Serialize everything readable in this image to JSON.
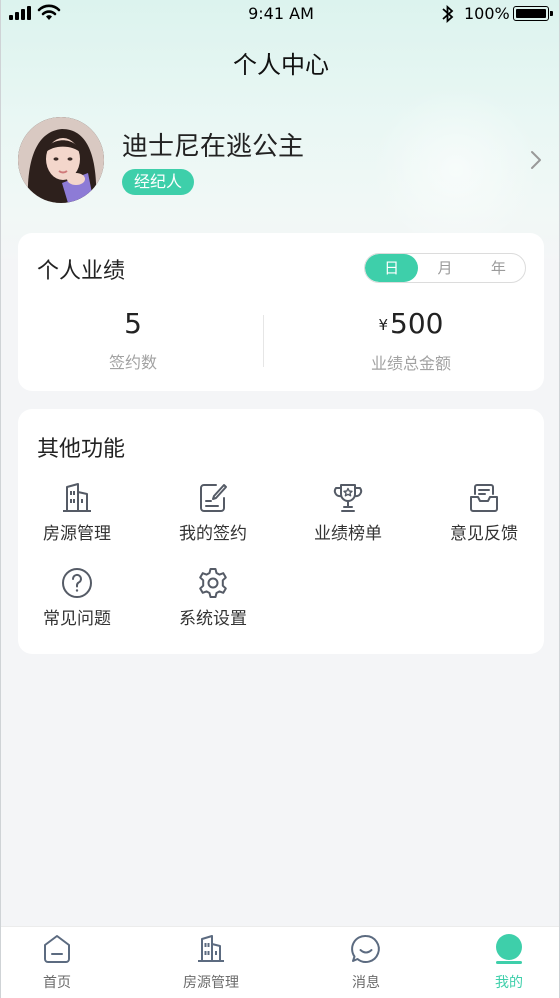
{
  "status_bar": {
    "time": "9:41 AM",
    "battery": "100%"
  },
  "header": {
    "title": "个人中心"
  },
  "profile": {
    "name": "迪士尼在逃公主",
    "role": "经纪人"
  },
  "performance": {
    "title": "个人业绩",
    "periods": [
      "日",
      "月",
      "年"
    ],
    "active_period": "日",
    "contracts": {
      "value": "5",
      "label": "签约数"
    },
    "total": {
      "currency": "¥",
      "value": "500",
      "label": "业绩总金额"
    }
  },
  "functions": {
    "title": "其他功能",
    "items": [
      {
        "label": "房源管理",
        "icon": "building-icon"
      },
      {
        "label": "我的签约",
        "icon": "edit-document-icon"
      },
      {
        "label": "业绩榜单",
        "icon": "trophy-icon"
      },
      {
        "label": "意见反馈",
        "icon": "inbox-icon"
      },
      {
        "label": "常见问题",
        "icon": "question-icon"
      },
      {
        "label": "系统设置",
        "icon": "gear-icon"
      }
    ]
  },
  "tabs": [
    {
      "label": "首页",
      "icon": "home-icon"
    },
    {
      "label": "房源管理",
      "icon": "building-icon"
    },
    {
      "label": "消息",
      "icon": "chat-icon"
    },
    {
      "label": "我的",
      "icon": "user-icon",
      "active": true
    }
  ],
  "colors": {
    "accent": "#3ecfaa",
    "icon": "#555b66"
  }
}
